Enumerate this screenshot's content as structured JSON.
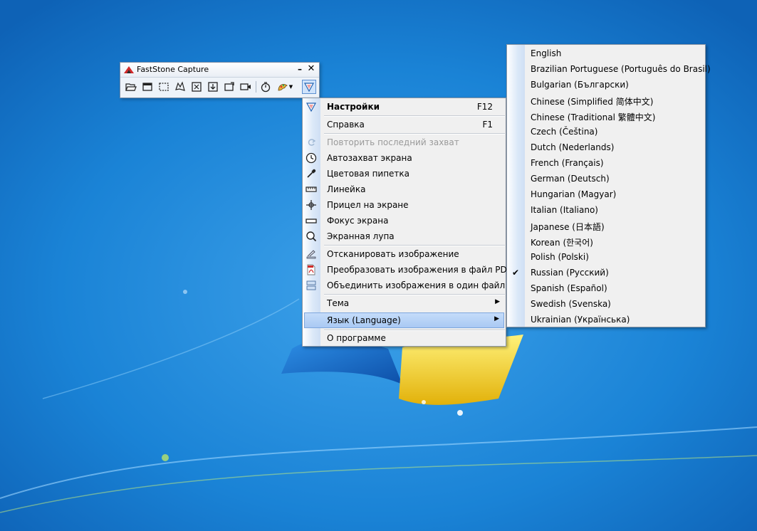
{
  "window": {
    "title": "FastStone Capture",
    "minimize_glyph": "–",
    "close_glyph": "✕",
    "tools": [
      {
        "icon": "open-folder-icon"
      },
      {
        "icon": "capture-window-icon"
      },
      {
        "icon": "capture-rectangle-icon"
      },
      {
        "icon": "capture-freehand-icon"
      },
      {
        "icon": "capture-fullscreen-icon"
      },
      {
        "icon": "capture-scrolling-icon"
      },
      {
        "icon": "capture-fixed-region-icon"
      },
      {
        "icon": "screen-recorder-icon"
      },
      {
        "icon": "timer-icon"
      },
      {
        "icon": "output-destination-icon"
      },
      {
        "icon": "settings-menu-icon"
      }
    ]
  },
  "menu": {
    "settings": {
      "label": "Настройки",
      "shortcut": "F12"
    },
    "help": {
      "label": "Справка",
      "shortcut": "F1"
    },
    "repeat": {
      "label": "Повторить последний захват"
    },
    "autocapture": {
      "label": "Автозахват экрана"
    },
    "colorpicker": {
      "label": "Цветовая пипетка"
    },
    "ruler": {
      "label": "Линейка"
    },
    "crosshair": {
      "label": "Прицел на экране"
    },
    "focus": {
      "label": "Фокус экрана"
    },
    "magnifier": {
      "label": "Экранная лупа"
    },
    "scan": {
      "label": "Отсканировать изображение"
    },
    "topdf": {
      "label": "Преобразовать изображения в файл PDF"
    },
    "combine": {
      "label": "Объединить изображения в один файл"
    },
    "theme": {
      "label": "Тема"
    },
    "language": {
      "label": "Язык (Language)"
    },
    "about": {
      "label": "О программе"
    },
    "submenu_arrow": "▶"
  },
  "languages": {
    "checkmark": "✔",
    "selected_index": 14,
    "items": [
      "English",
      "Brazilian Portuguese (Português do Brasil)",
      "Bulgarian (Български)",
      "Chinese (Simplified 简体中文)",
      "Chinese (Traditional 繁體中文)",
      "Czech (Čeština)",
      "Dutch (Nederlands)",
      "French (Français)",
      "German (Deutsch)",
      "Hungarian (Magyar)",
      "Italian (Italiano)",
      "Japanese (日本語)",
      "Korean (한국어)",
      "Polish (Polski)",
      "Russian (Русский)",
      "Spanish (Español)",
      "Swedish (Svenska)",
      "Ukrainian (Українська)"
    ]
  },
  "colors": {
    "desktop_blue": "#1b86d6",
    "menu_highlight": "#a9c9f3"
  }
}
